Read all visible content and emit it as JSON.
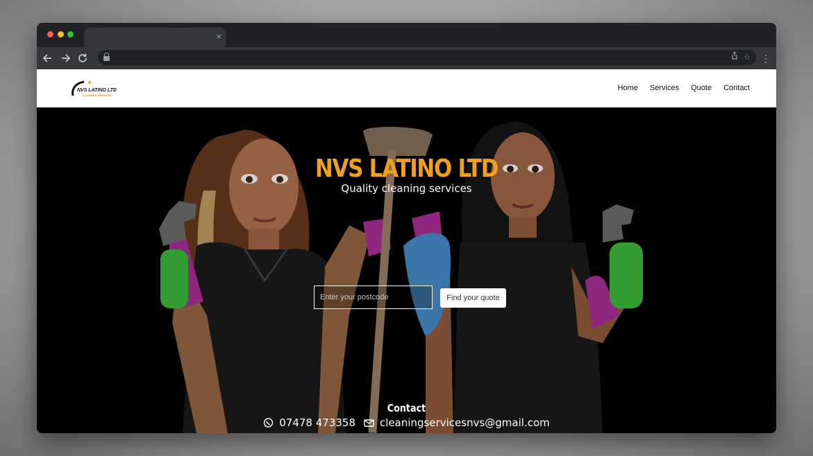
{
  "browser": {
    "tab_close": "×",
    "icons": {
      "back": "arrow-left-icon",
      "forward": "arrow-right-icon",
      "reload": "reload-icon",
      "lock": "lock-icon",
      "share": "share-icon",
      "bookmark": "star-icon",
      "menu": "kebab-menu-icon"
    }
  },
  "header": {
    "logo_text": "NVS LATINO LTD",
    "logo_subtext": "CLEANING SERVICES",
    "nav": [
      "Home",
      "Services",
      "Quote",
      "Contact"
    ]
  },
  "hero": {
    "title": "NVS LATINO LTD",
    "subtitle": "Quality cleaning services",
    "postcode_placeholder": "Enter your postcode",
    "postcode_value": "",
    "quote_button": "Find your quote"
  },
  "contact": {
    "heading": "Contact",
    "phone": "07478 473358",
    "email": "cleaningservicesnvs@gmail.com"
  },
  "colors": {
    "title": "#f0a020",
    "hero_bg": "#000000",
    "glove": "#b0309a",
    "bottle": "#3fbf3f",
    "towel": "#4a8fd0"
  }
}
